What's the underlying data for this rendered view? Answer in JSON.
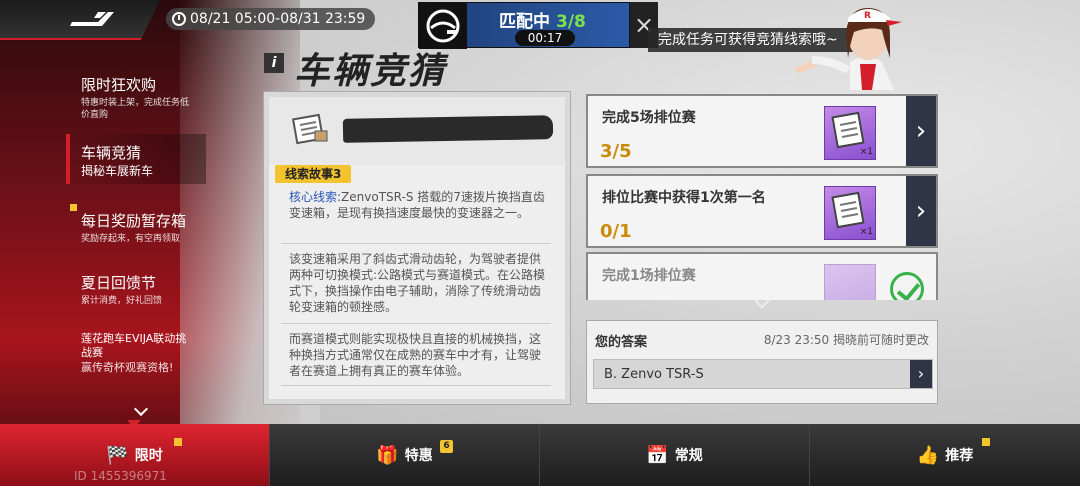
{
  "header": {
    "event_time": "08/21 05:00-08/31 23:59",
    "match_status": "匹配中",
    "match_count": "3/8",
    "match_timer": "00:17",
    "hint": "完成任务可获得竞猜线索哦~"
  },
  "sidebar": {
    "items": [
      {
        "title": "限时狂欢购",
        "sub": "特惠时装上架，完成任务低价直购"
      },
      {
        "title": "车辆竞猜",
        "sub": "揭秘车展新车"
      },
      {
        "title": "每日奖励暂存箱",
        "sub": "奖励存起来，有空再领取"
      },
      {
        "title": "夏日回馈节",
        "sub": "累计消费，好礼回馈"
      },
      {
        "title": "莲花跑车EVIJA联动挑战赛",
        "sub": "赢传奇杯观赛资格!"
      }
    ]
  },
  "page": {
    "title": "车辆竞猜"
  },
  "clue": {
    "tag": "线索故事3",
    "key_label": "核心线索:",
    "p1": "ZenvoTSR-S 搭载的7速拨片换挡直齿变速箱，是现有换挡速度最快的变速器之一。",
    "p2": "该变速箱采用了斜齿式滑动齿轮，为驾驶者提供两种可切换模式:公路模式与赛道模式。在公路模式下，换挡操作由电子辅助，消除了传统滑动齿轮变速箱的顿挫感。",
    "p3": "而赛道模式则能实现极快且直接的机械换挡，这种换挡方式通常仅在成熟的赛车中才有，让驾驶者在赛道上拥有真正的赛车体验。"
  },
  "tasks": [
    {
      "name": "完成5场排位赛",
      "progress": "3/5",
      "reward_qty": "×1"
    },
    {
      "name": "排位比赛中获得1次第一名",
      "progress": "0/1",
      "reward_qty": "×1"
    },
    {
      "name": "完成1场排位赛",
      "progress": "",
      "reward_qty": ""
    }
  ],
  "answer": {
    "label": "您的答案",
    "note": "8/23 23:50 揭晓前可随时更改",
    "value": "B. Zenvo TSR-S"
  },
  "nav": {
    "tabs": [
      {
        "label": "限时"
      },
      {
        "label": "特惠",
        "badge": "6"
      },
      {
        "label": "常规"
      },
      {
        "label": "推荐"
      }
    ],
    "player_id": "ID 1455396971"
  },
  "colors": {
    "accent_red": "#d41e2a",
    "gold": "#f4c430",
    "progress": "#c88b0a",
    "clue_key": "#2c55b8",
    "complete_green": "#38b24a"
  }
}
